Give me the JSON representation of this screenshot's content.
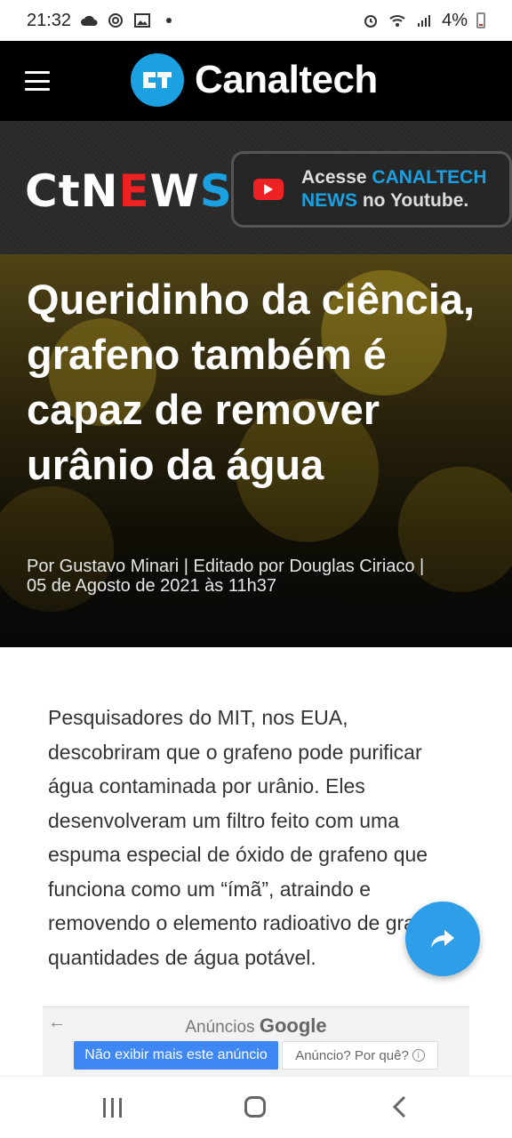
{
  "status_bar": {
    "time": "21:32",
    "battery": "4%",
    "icons": [
      "cloud-icon",
      "at-icon",
      "image-icon",
      "dot-icon",
      "alarm-icon",
      "wifi-icon",
      "signal-icon",
      "battery-icon"
    ]
  },
  "header": {
    "brand_badge": "CT",
    "brand_name": "Canaltech",
    "menu_icon": "menu-icon"
  },
  "banner": {
    "logo_parts": [
      "Ct",
      "N",
      "E",
      "W",
      "S"
    ],
    "youtube_text_1": "Acesse ",
    "youtube_text_2": "CANALTECH",
    "youtube_text_3": "NEWS",
    "youtube_text_4": " no Youtube."
  },
  "article": {
    "title": "Queridinho da ciência, grafeno também é capaz de remover urânio da água",
    "byline_1": "Por Gustavo Minari | Editado por Douglas Ciriaco |",
    "byline_2": "05 de Agosto de 2021 às 11h37",
    "body": "Pesquisadores do MIT, nos EUA, descobriram que o grafeno pode purificar água contaminada por urânio. Eles desenvolveram um filtro feito com uma espuma especial de óxido de grafeno que funciona como um “ímã”, atraindo e removendo o elemento radioativo de grandes quantidades de água potável."
  },
  "ad": {
    "label": "Anúncios ",
    "label_brand": "Google",
    "hide_button": "Não exibir mais este anúncio",
    "why_button": "Anúncio? Por quê?"
  },
  "colors": {
    "accent": "#1ba1e2",
    "header_bg": "#000000",
    "fab": "#2f9ee8",
    "ad_primary": "#3f87f5"
  }
}
